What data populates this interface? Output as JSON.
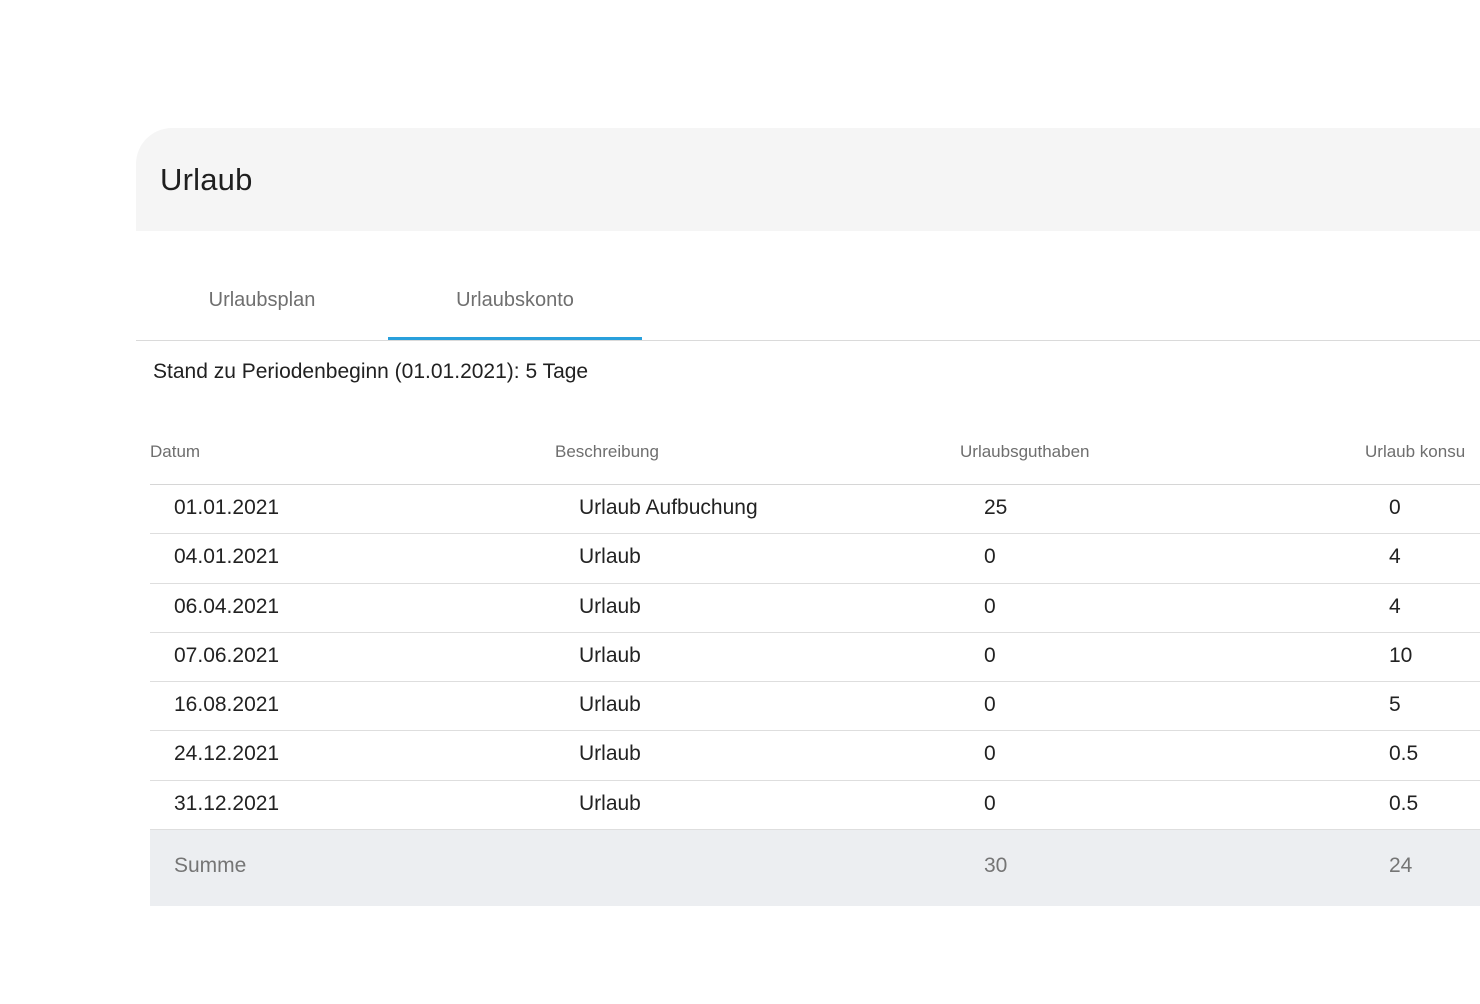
{
  "card": {
    "title": "Urlaub"
  },
  "tabs": [
    {
      "label": "Urlaubsplan",
      "active": false
    },
    {
      "label": "Urlaubskonto",
      "active": true
    }
  ],
  "accent_color": "#29a0dc",
  "stand_text": "Stand zu Periodenbeginn (01.01.2021): 5 Tage",
  "table": {
    "headers": [
      "Datum",
      "Beschreibung",
      "Urlaubsguthaben",
      "Urlaub konsu"
    ],
    "rows": [
      [
        "01.01.2021",
        "Urlaub Aufbuchung",
        "25",
        "0"
      ],
      [
        "04.01.2021",
        "Urlaub",
        "0",
        "4"
      ],
      [
        "06.04.2021",
        "Urlaub",
        "0",
        "4"
      ],
      [
        "07.06.2021",
        "Urlaub",
        "0",
        "10"
      ],
      [
        "16.08.2021",
        "Urlaub",
        "0",
        "5"
      ],
      [
        "24.12.2021",
        "Urlaub",
        "0",
        "0.5"
      ],
      [
        "31.12.2021",
        "Urlaub",
        "0",
        "0.5"
      ]
    ],
    "sum": {
      "label": "Summe",
      "guthaben": "30",
      "konsumiert": "24"
    }
  }
}
